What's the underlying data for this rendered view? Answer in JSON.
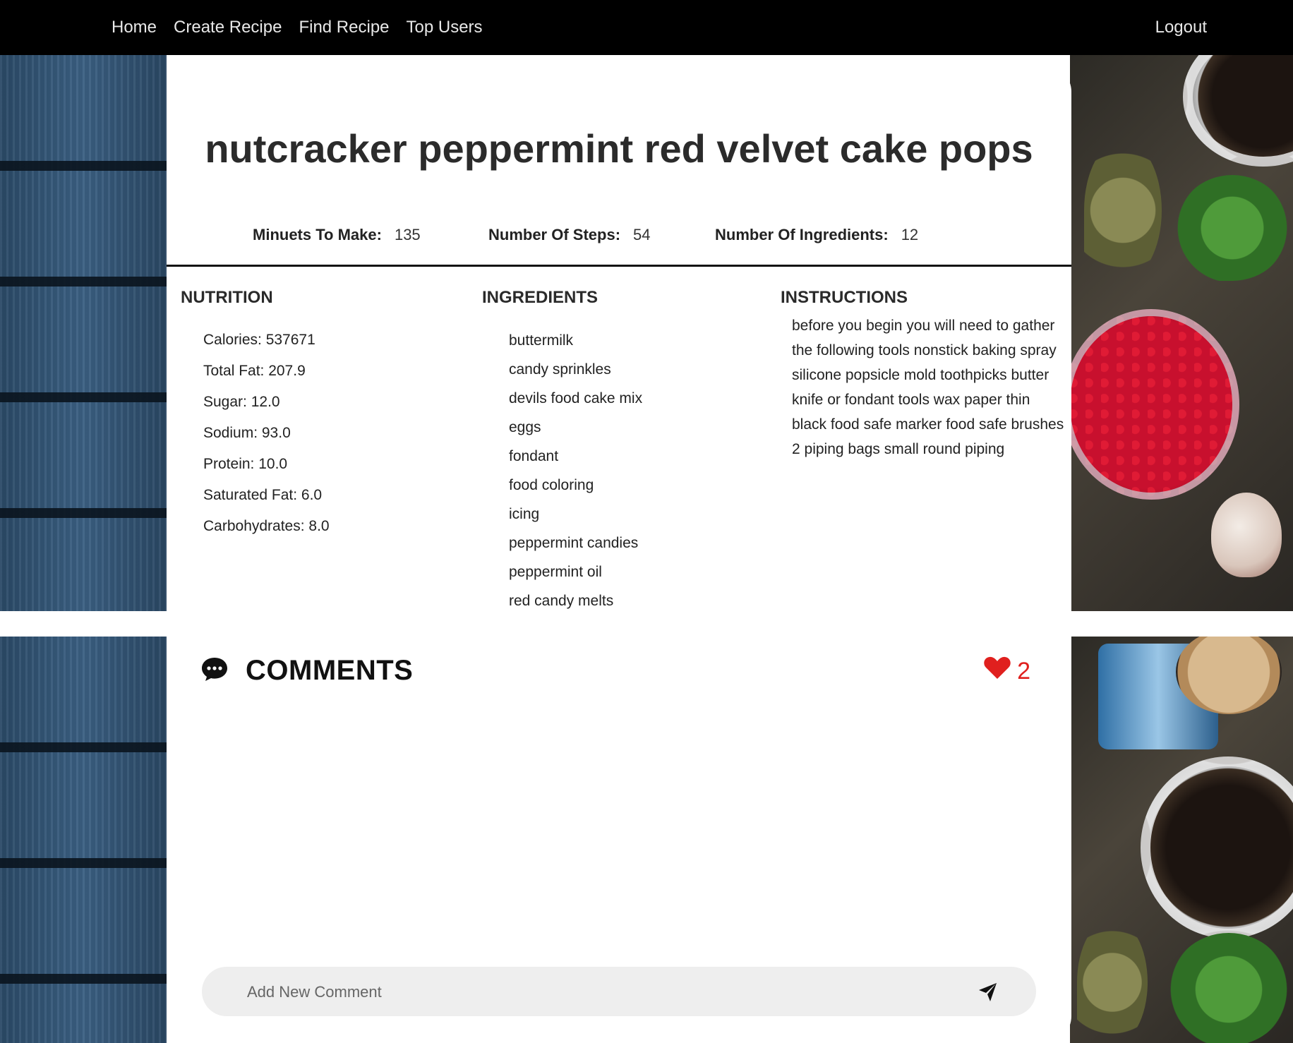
{
  "nav": {
    "links": [
      "Home",
      "Create Recipe",
      "Find Recipe",
      "Top Users"
    ],
    "logout": "Logout"
  },
  "recipe": {
    "title": "nutcracker peppermint red velvet cake pops",
    "stats": {
      "minutes_label": "Minuets To Make:",
      "minutes_value": "135",
      "steps_label": "Number Of Steps:",
      "steps_value": "54",
      "ingredients_label": "Number Of Ingredients:",
      "ingredients_value": "12"
    },
    "nutrition": {
      "heading": "NUTRITION",
      "items": [
        "Calories: 537671",
        "Total Fat: 207.9",
        "Sugar: 12.0",
        "Sodium: 93.0",
        "Protein: 10.0",
        "Saturated Fat: 6.0",
        "Carbohydrates: 8.0"
      ]
    },
    "ingredients": {
      "heading": "INGREDIENTS",
      "items": [
        "buttermilk",
        "candy sprinkles",
        "devils food cake mix",
        "eggs",
        "fondant",
        "food coloring",
        "icing",
        "peppermint candies",
        "peppermint oil",
        "red candy melts"
      ]
    },
    "instructions": {
      "heading": "INSTRUCTIONS",
      "text": "before you begin you will need to gather the following tools nonstick baking spray silicone popsicle mold toothpicks butter knife or fondant tools wax paper thin black food safe marker food safe brushes 2 piping bags small round piping"
    }
  },
  "comments": {
    "title": "COMMENTS",
    "likes": "2",
    "placeholder": "Add New Comment"
  },
  "colors": {
    "navbar": "#000000",
    "heart": "#e0201e",
    "comment_bar": "#eeeeee"
  },
  "icons": [
    "chat-bubble-icon",
    "heart-icon",
    "send-icon"
  ]
}
